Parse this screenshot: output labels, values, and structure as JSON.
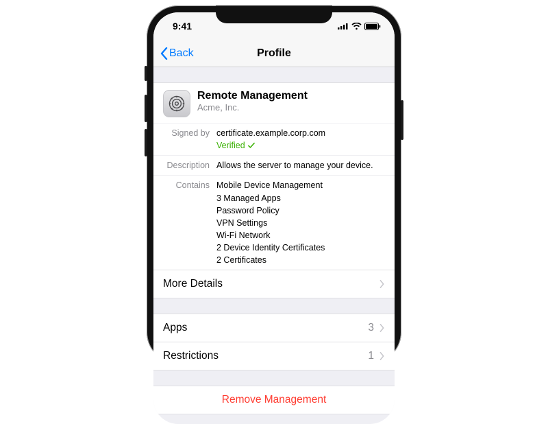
{
  "status": {
    "time": "9:41"
  },
  "nav": {
    "back": "Back",
    "title": "Profile"
  },
  "profile": {
    "name": "Remote Management",
    "org": "Acme, Inc.",
    "signed_by_label": "Signed by",
    "signed_by_value": "certificate.example.corp.com",
    "verified_label": "Verified",
    "description_label": "Description",
    "description_value": "Allows the server to manage your device.",
    "contains_label": "Contains",
    "contains": [
      "Mobile Device Management",
      "3 Managed Apps",
      "Password Policy",
      "VPN Settings",
      "Wi-Fi Network",
      "2 Device Identity Certificates",
      "2 Certificates"
    ]
  },
  "rows": {
    "more_details": "More Details",
    "apps_label": "Apps",
    "apps_count": "3",
    "restrictions_label": "Restrictions",
    "restrictions_count": "1",
    "remove": "Remove Management"
  }
}
